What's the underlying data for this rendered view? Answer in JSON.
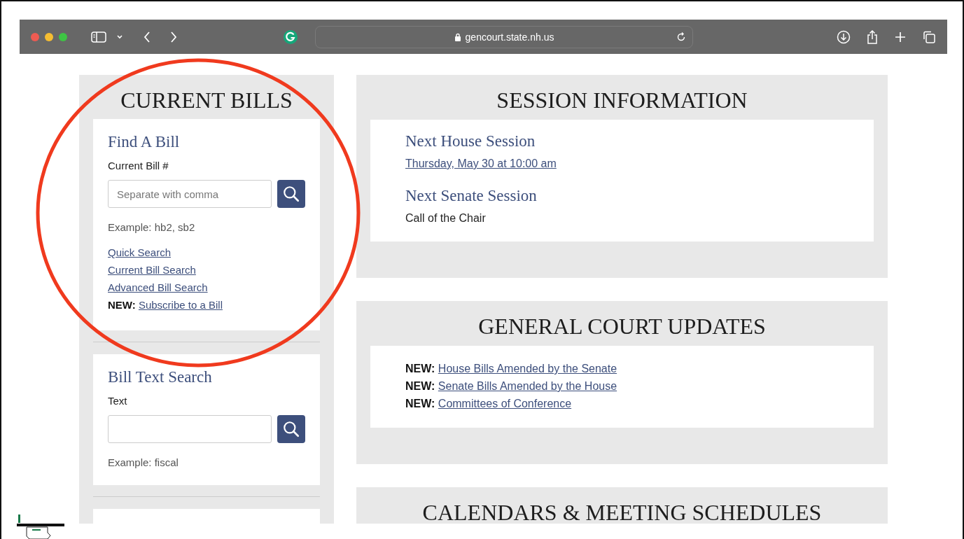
{
  "browser": {
    "url": "gencourt.state.nh.us"
  },
  "current_bills": {
    "title": "CURRENT BILLS",
    "find": {
      "heading": "Find A Bill",
      "label": "Current Bill #",
      "placeholder": "Separate with comma",
      "example": "Example: hb2, sb2",
      "links": [
        {
          "text": "Quick Search"
        },
        {
          "text": "Current Bill Search"
        },
        {
          "text": "Advanced Bill Search"
        },
        {
          "prefix": "NEW:",
          "text": "Subscribe to a Bill"
        }
      ]
    },
    "text_search": {
      "heading": "Bill Text Search",
      "label": "Text",
      "example": "Example: fiscal"
    }
  },
  "session": {
    "title": "SESSION INFORMATION",
    "items": [
      {
        "heading": "Next House Session",
        "value": "Thursday, May 30 at 10:00 am",
        "kind": "link"
      },
      {
        "heading": "Next Senate Session",
        "value": "Call of the Chair",
        "kind": "text"
      }
    ]
  },
  "updates": {
    "title": "GENERAL COURT UPDATES",
    "items": [
      {
        "prefix": "NEW:",
        "text": "House Bills Amended by the Senate"
      },
      {
        "prefix": "NEW:",
        "text": "Senate Bills Amended by the House"
      },
      {
        "prefix": "NEW:",
        "text": "Committees of Conference"
      }
    ]
  },
  "calendars": {
    "title": "CALENDARS & MEETING SCHEDULES"
  }
}
